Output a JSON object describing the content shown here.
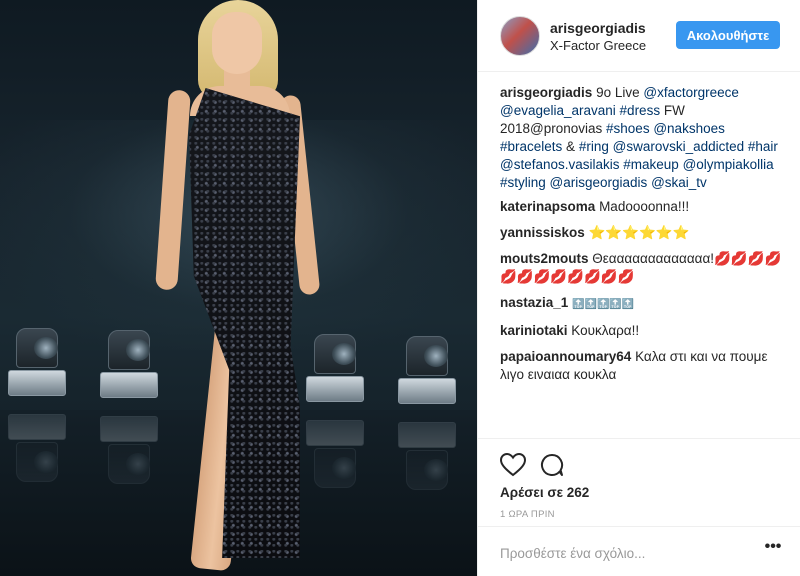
{
  "header": {
    "username": "arisgeorgiadis",
    "location": "X-Factor Greece",
    "follow_label": "Ακολουθήστε"
  },
  "caption": {
    "username": "arisgeorgiadis",
    "parts": [
      {
        "text": "9o Live ",
        "tag": false
      },
      {
        "text": "@xfactorgreece",
        "tag": true
      },
      {
        "text": " ",
        "tag": false
      },
      {
        "text": "@evagelia_aravani",
        "tag": true
      },
      {
        "text": " ",
        "tag": false
      },
      {
        "text": "#dress",
        "tag": true
      },
      {
        "text": " FW 2018@pronovias ",
        "tag": false
      },
      {
        "text": "#shoes",
        "tag": true
      },
      {
        "text": " ",
        "tag": false
      },
      {
        "text": "@nakshoes",
        "tag": true
      },
      {
        "text": " ",
        "tag": false
      },
      {
        "text": "#bracelets",
        "tag": true
      },
      {
        "text": " & ",
        "tag": false
      },
      {
        "text": "#ring",
        "tag": true
      },
      {
        "text": " ",
        "tag": false
      },
      {
        "text": "@swarovski_addicted",
        "tag": true
      },
      {
        "text": " ",
        "tag": false
      },
      {
        "text": "#hair",
        "tag": true
      },
      {
        "text": " ",
        "tag": false
      },
      {
        "text": "@stefanos.vasilakis",
        "tag": true
      },
      {
        "text": " ",
        "tag": false
      },
      {
        "text": "#makeup",
        "tag": true
      },
      {
        "text": " ",
        "tag": false
      },
      {
        "text": "@olympiakollia",
        "tag": true
      },
      {
        "text": " ",
        "tag": false
      },
      {
        "text": "#styling",
        "tag": true
      },
      {
        "text": " ",
        "tag": false
      },
      {
        "text": "@arisgeorgiadis",
        "tag": true
      },
      {
        "text": " ",
        "tag": false
      },
      {
        "text": "@skai_tv",
        "tag": true
      }
    ]
  },
  "comments": [
    {
      "username": "katerinapsoma",
      "text": "Madoooonna!!!"
    },
    {
      "username": "yannissiskos",
      "text": "⭐⭐⭐⭐⭐⭐"
    },
    {
      "username": "mouts2mouts",
      "text": "Θεααααααααααααα!💋💋💋💋💋💋💋💋💋💋💋💋"
    },
    {
      "username": "nastazia_1",
      "text": "🔝🔝🔝🔝🔝"
    },
    {
      "username": "kariniotaki",
      "text": "Κουκλαρα!!"
    },
    {
      "username": "papaioannoumary64",
      "text": "Καλα στι και να πουμε λιγο ειναιαα κουκλα"
    }
  ],
  "actions": {
    "likes_label": "Αρέσει σε 262",
    "time_label": "1 ΩΡΑ ΠΡΙΝ"
  },
  "add_comment": {
    "placeholder": "Προσθέστε ένα σχόλιο...",
    "more_label": "•••"
  },
  "colors": {
    "accent": "#3897f0",
    "link": "#003569",
    "muted": "#999999"
  }
}
